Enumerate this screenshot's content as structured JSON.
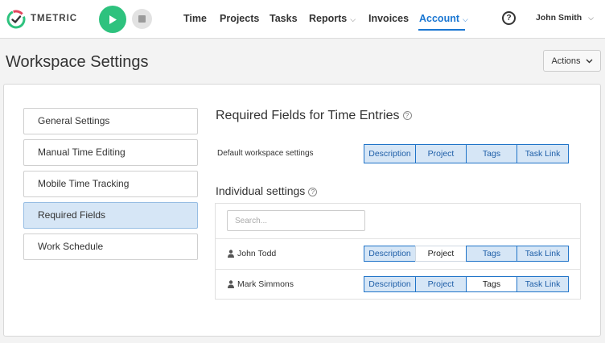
{
  "brand": {
    "name": "TMETRIC"
  },
  "nav": {
    "items": [
      {
        "label": "Time",
        "dropdown": false
      },
      {
        "label": "Projects",
        "dropdown": false
      },
      {
        "label": "Tasks",
        "dropdown": false
      },
      {
        "label": "Reports",
        "dropdown": true
      },
      {
        "label": "Invoices",
        "dropdown": false
      },
      {
        "label": "Account",
        "dropdown": true,
        "active": true
      }
    ],
    "user_name": "John Smith",
    "help_glyph": "?"
  },
  "page": {
    "title": "Workspace Settings",
    "actions_label": "Actions"
  },
  "sidebar": {
    "items": [
      {
        "label": "General Settings"
      },
      {
        "label": "Manual Time Editing"
      },
      {
        "label": "Mobile Time Tracking"
      },
      {
        "label": "Required Fields",
        "active": true
      },
      {
        "label": "Work Schedule"
      }
    ]
  },
  "required_fields": {
    "title": "Required Fields for Time Entries",
    "default_label": "Default workspace settings",
    "default_options": [
      {
        "label": "Description",
        "on": true
      },
      {
        "label": "Project",
        "on": true
      },
      {
        "label": "Tags",
        "on": true
      },
      {
        "label": "Task Link",
        "on": true
      }
    ]
  },
  "individual": {
    "title": "Individual settings",
    "search_placeholder": "Search...",
    "users": [
      {
        "name": "John Todd",
        "options": [
          {
            "label": "Description",
            "on": true
          },
          {
            "label": "Project",
            "on": false
          },
          {
            "label": "Tags",
            "on": true
          },
          {
            "label": "Task Link",
            "on": true
          }
        ]
      },
      {
        "name": "Mark Simmons",
        "options": [
          {
            "label": "Description",
            "on": true
          },
          {
            "label": "Project",
            "on": true
          },
          {
            "label": "Tags",
            "on": false
          },
          {
            "label": "Task Link",
            "on": true
          }
        ]
      }
    ]
  },
  "colors": {
    "accent": "#1976d2",
    "play": "#2ec27e",
    "selected_bg": "#d6e6f6"
  }
}
